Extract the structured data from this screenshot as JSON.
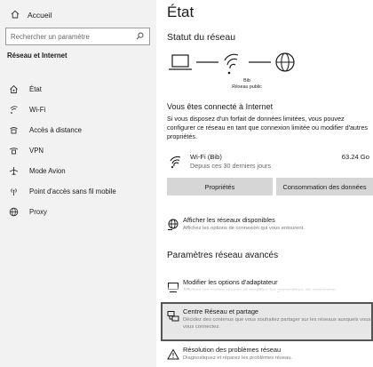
{
  "sidebar": {
    "home_label": "Accueil",
    "search_placeholder": "Rechercher un paramètre",
    "section_title": "Réseau et Internet",
    "items": [
      {
        "label": "État",
        "icon": "home-status-icon"
      },
      {
        "label": "Wi-Fi",
        "icon": "wifi-icon"
      },
      {
        "label": "Accès à distance",
        "icon": "dialup-icon"
      },
      {
        "label": "VPN",
        "icon": "vpn-icon"
      },
      {
        "label": "Mode Avion",
        "icon": "airplane-icon"
      },
      {
        "label": "Point d'accès sans fil mobile",
        "icon": "hotspot-icon"
      },
      {
        "label": "Proxy",
        "icon": "globe-icon"
      }
    ]
  },
  "main": {
    "title": "État",
    "network_status_title": "Statut du réseau",
    "network_name": "Bib",
    "network_type": "Réseau public",
    "connected_title": "Vous êtes connecté à Internet",
    "connected_desc": "Si vous disposez d'un forfait de données limitées, vous pouvez configurer ce réseau en tant que connexion limitée ou modifier d'autres propriétés.",
    "wifi": {
      "name": "Wi-Fi (Bib)",
      "since": "Depuis ces 30 derniers jours",
      "usage": "63.24 Go"
    },
    "buttons": {
      "properties": "Propriétés",
      "data_usage": "Consommation des données"
    },
    "show_networks": {
      "title": "Afficher les réseaux disponibles",
      "desc": "Affichez les options de connexion qui vous entourent."
    },
    "advanced_title": "Paramètres réseau avancés",
    "adapter": {
      "title": "Modifier les options d'adaptateur",
      "desc": "Affichez les cartes réseau et modifiez les paramètres de connexion."
    },
    "sharing_center": {
      "title": "Centre Réseau et partage",
      "desc": "Décidez des contenus que vous souhaitez partager sur les réseaux auxquels vous vous connectez."
    },
    "troubleshoot": {
      "title": "Résolution des problèmes réseau",
      "desc": "Diagnostiquez et réparez les problèmes réseau."
    }
  }
}
